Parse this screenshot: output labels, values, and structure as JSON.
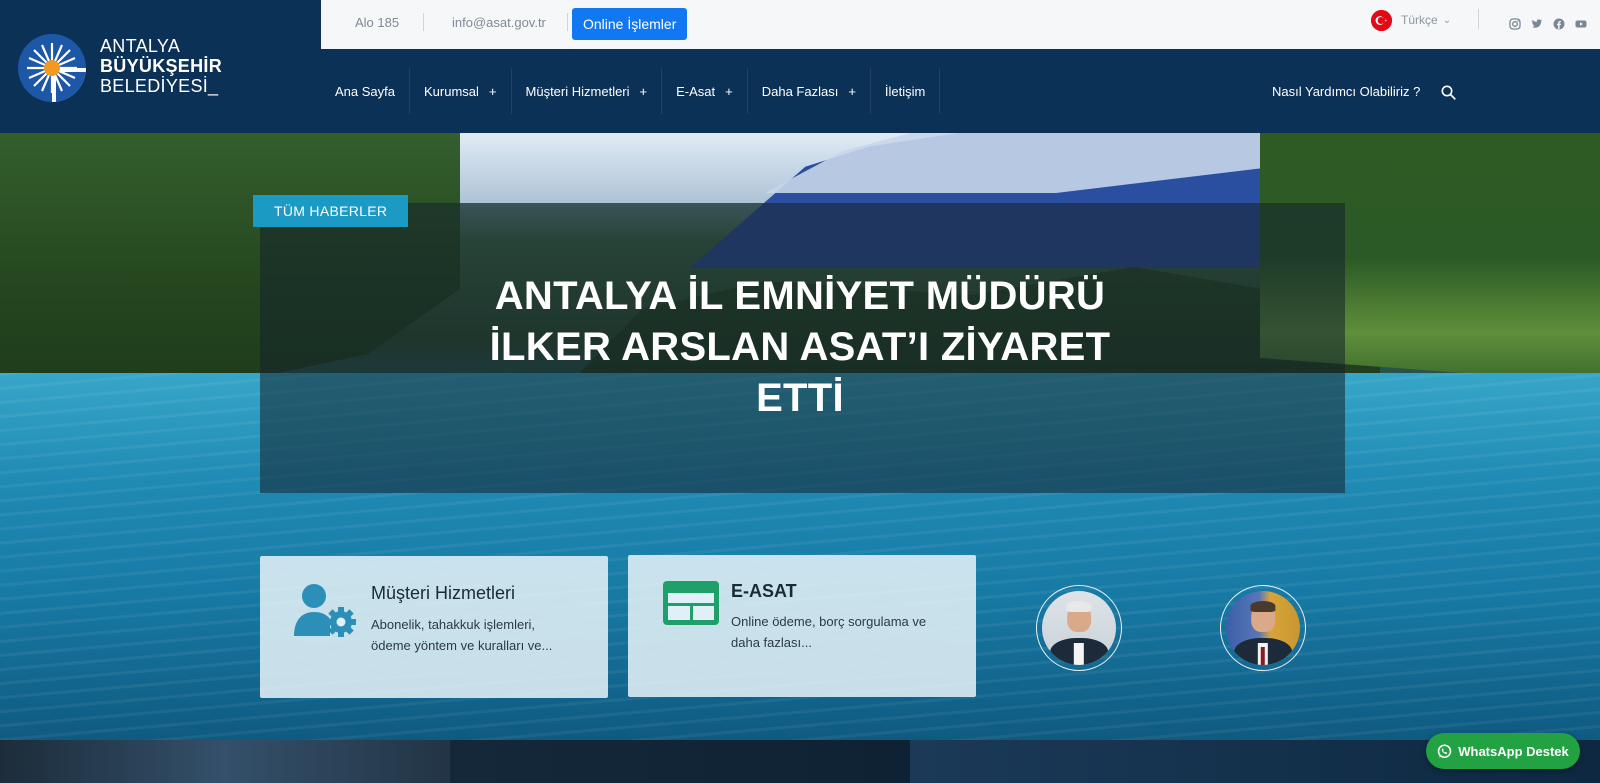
{
  "logo": {
    "line1": "ANTALYA",
    "line2": "BÜYÜKŞEHİR",
    "line3": "BELEDİYESİ_",
    "icon": "sun-emblem-icon"
  },
  "topbar": {
    "phone": "Alo 185",
    "email": "info@asat.gov.tr",
    "online_button": "Online İşlemler",
    "language": "Türkçe",
    "language_icon": "turkey-flag-icon",
    "social_icons": [
      "instagram-icon",
      "twitter-icon",
      "facebook-icon",
      "youtube-icon"
    ]
  },
  "nav": {
    "items": [
      {
        "label": "Ana Sayfa",
        "has_plus": false
      },
      {
        "label": "Kurumsal",
        "has_plus": true
      },
      {
        "label": "Müşteri Hizmetleri",
        "has_plus": true
      },
      {
        "label": "E-Asat",
        "has_plus": true
      },
      {
        "label": "Daha Fazlası",
        "has_plus": true
      },
      {
        "label": "İletişim",
        "has_plus": false
      }
    ],
    "plus_symbol": "+",
    "help_text": "Nasıl Yardımcı Olabiliriz ?",
    "search_icon": "search-icon"
  },
  "hero": {
    "tag": "TÜM HABERLER",
    "headline": "ANTALYA İL EMNİYET MÜDÜRÜ İLKER ARSLAN ASAT’I ZİYARET ETTİ"
  },
  "cards": [
    {
      "title": "Müşteri Hizmetleri",
      "description": "Abonelik, tahakkuk işlemleri, ödeme yöntem ve kuralları ve...",
      "icon": "user-gear-icon",
      "icon_color": "#2c8fb7"
    },
    {
      "title": "E-ASAT",
      "description": "Online ödeme, borç sorgulama ve daha fazlası...",
      "icon": "browser-window-icon",
      "icon_color": "#1fa06a"
    }
  ],
  "people": [
    {
      "icon": "official-portrait-1"
    },
    {
      "icon": "official-portrait-2"
    }
  ],
  "whatsapp": {
    "label": "WhatsApp Destek",
    "icon": "whatsapp-icon",
    "color": "#23a244"
  },
  "colors": {
    "navy": "#0c3157",
    "accent_blue": "#1178f2",
    "tag_blue": "#1b9ac4"
  }
}
